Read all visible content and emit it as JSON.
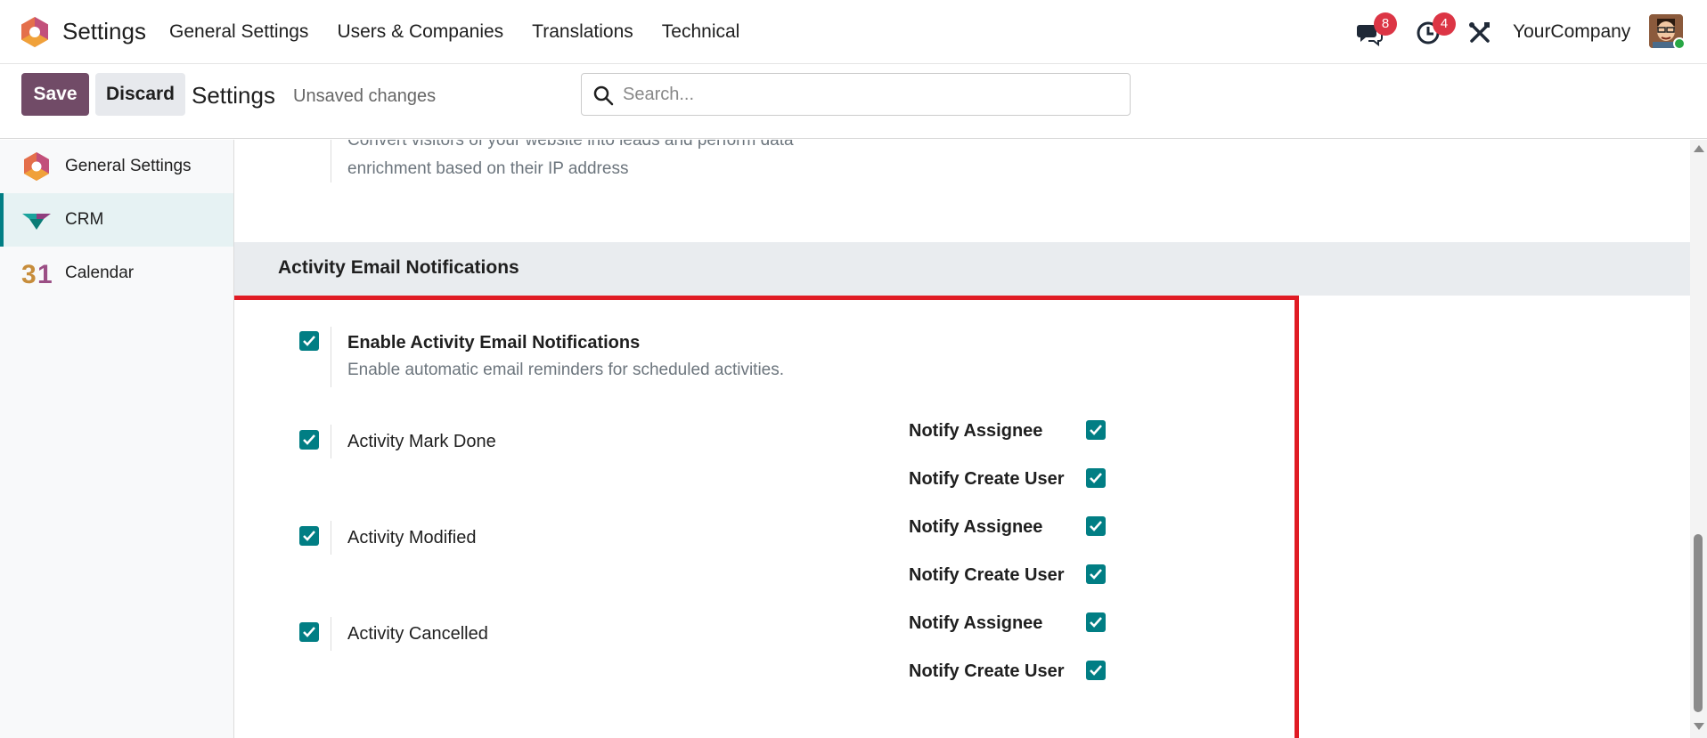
{
  "navbar": {
    "app_name": "Settings",
    "menu": [
      "General Settings",
      "Users & Companies",
      "Translations",
      "Technical"
    ],
    "messages_count": "8",
    "activities_count": "4",
    "company": "YourCompany"
  },
  "control": {
    "save_label": "Save",
    "discard_label": "Discard",
    "breadcrumb": "Settings",
    "unsaved": "Unsaved changes",
    "search_placeholder": "Search..."
  },
  "sidebar": {
    "items": [
      {
        "label": "General Settings",
        "icon": "settings-app-icon"
      },
      {
        "label": "CRM",
        "icon": "crm-app-icon",
        "active": true
      },
      {
        "label": "Calendar",
        "icon": "calendar-app-icon",
        "icon_text": "31"
      }
    ]
  },
  "main": {
    "prev_desc_line1": "Convert visitors of your website into leads and perform data",
    "prev_desc_line2": "enrichment based on their IP address",
    "section_title": "Activity Email Notifications",
    "enable": {
      "title": "Enable Activity Email Notifications",
      "desc": "Enable automatic email reminders for scheduled activities.",
      "checked": true
    },
    "rows": [
      {
        "label": "Activity Mark Done",
        "checked": true,
        "notify_assignee": "Notify Assignee",
        "notify_create_user": "Notify Create User"
      },
      {
        "label": "Activity Modified",
        "checked": true,
        "notify_assignee": "Notify Assignee",
        "notify_create_user": "Notify Create User"
      },
      {
        "label": "Activity Cancelled",
        "checked": true,
        "notify_assignee": "Notify Assignee",
        "notify_create_user": "Notify Create User"
      }
    ]
  },
  "colors": {
    "brand": "#714b67",
    "checkbox": "#017e84",
    "badge": "#dc3545",
    "highlight": "#e01b24"
  }
}
